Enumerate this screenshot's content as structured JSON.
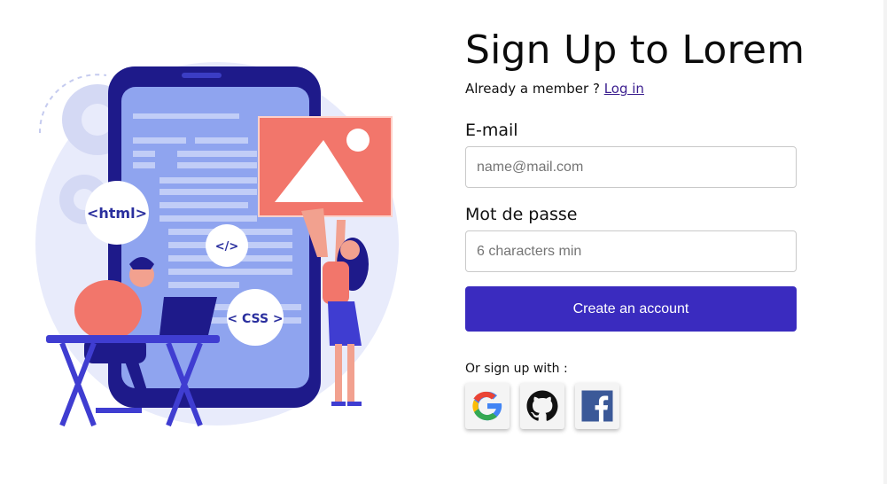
{
  "header": {
    "title": "Sign Up to Lorem",
    "member_text": "Already a member ?",
    "login_link": "Log in"
  },
  "form": {
    "email_label": "E-mail",
    "email_placeholder": "name@mail.com",
    "email_value": "",
    "password_label": "Mot de passe",
    "password_placeholder": "6 characters min",
    "password_value": "",
    "submit_label": "Create an account"
  },
  "social": {
    "label": "Or sign up with :",
    "providers": [
      {
        "name": "google",
        "icon": "google-icon"
      },
      {
        "name": "github",
        "icon": "github-icon"
      },
      {
        "name": "facebook",
        "icon": "facebook-icon"
      }
    ]
  },
  "illustration": {
    "badges": [
      "<html>",
      "</>",
      "< CSS >"
    ],
    "icon": "developer-illustration"
  },
  "colors": {
    "accent": "#3a2bbf",
    "link": "#3b1e8f",
    "illustration_primary": "#1e1a8a",
    "illustration_accent": "#f2766b"
  }
}
